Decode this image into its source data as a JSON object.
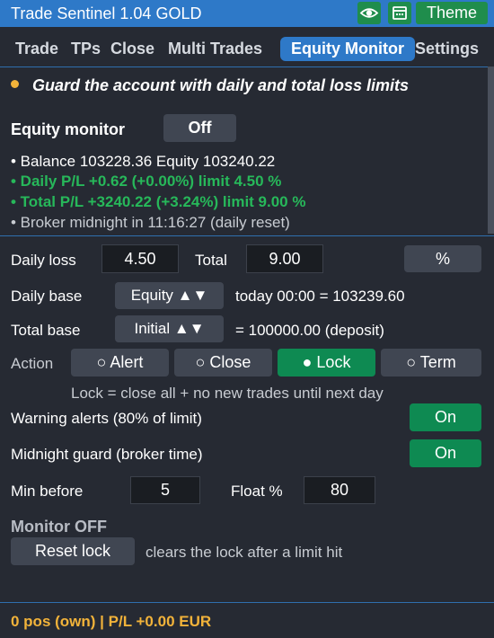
{
  "titlebar": {
    "title": "Trade Sentinel 1.04  GOLD",
    "icons": [
      "eye-icon",
      "calendar-icon"
    ],
    "theme_label": "Theme"
  },
  "tabs": [
    {
      "label": "Trade",
      "active": false
    },
    {
      "label": "TPs",
      "active": false
    },
    {
      "label": "Close",
      "active": false
    },
    {
      "label": "Multi Trades",
      "active": false
    },
    {
      "label": "Equity Monitor",
      "active": true
    },
    {
      "label": "Settings",
      "active": false
    }
  ],
  "info": {
    "subtitle": "Guard the account with daily and total loss limits",
    "equity_monitor_label": "Equity monitor",
    "equity_monitor_toggle": "Off",
    "balance_line": "•  Balance 103228.36    Equity 103240.22",
    "daily_pl_line": "•  Daily P/L +0.62 (+0.00%)   limit 4.50 %",
    "total_pl_line": "•  Total P/L +3240.22 (+3.24%)   limit 9.00 %",
    "midnight_line": "•  Broker midnight in 11:16:27 (daily reset)"
  },
  "limits": {
    "daily_loss_label": "Daily loss",
    "daily_loss_value": "4.50",
    "total_label": "Total",
    "total_value": "9.00",
    "unit_button": "%"
  },
  "daily_base": {
    "label": "Daily base",
    "select": "Equity ▲▼",
    "info": "today 00:00 = 103239.60"
  },
  "total_base": {
    "label": "Total base",
    "select": "Initial ▲▼",
    "info": "= 100000.00 (deposit)"
  },
  "action": {
    "label": "Action",
    "options": [
      "○  Alert",
      "○  Close",
      "●  Lock",
      "○  Term"
    ],
    "selected_index": 2,
    "description": "Lock = close all + no new trades until next day"
  },
  "warning_alerts": {
    "label": "Warning alerts (80% of limit)",
    "toggle": "On"
  },
  "midnight_guard": {
    "label": "Midnight guard (broker time)",
    "toggle": "On"
  },
  "min_before": {
    "label": "Min before",
    "value": "5",
    "float_label": "Float %",
    "float_value": "80"
  },
  "monitor": {
    "status": "Monitor OFF",
    "reset_button": "Reset lock",
    "reset_info": "clears the lock after a limit hit"
  },
  "status_bar": "0 pos (own)  |  P/L +0.00 EUR",
  "colors": {
    "background": "#262a33",
    "titlebar": "#2e79c8",
    "active_tab": "#2e79c8",
    "green": "#0e8a52",
    "green_text": "#27b85a",
    "accent_orange": "#f2b33a",
    "button": "#404652"
  }
}
